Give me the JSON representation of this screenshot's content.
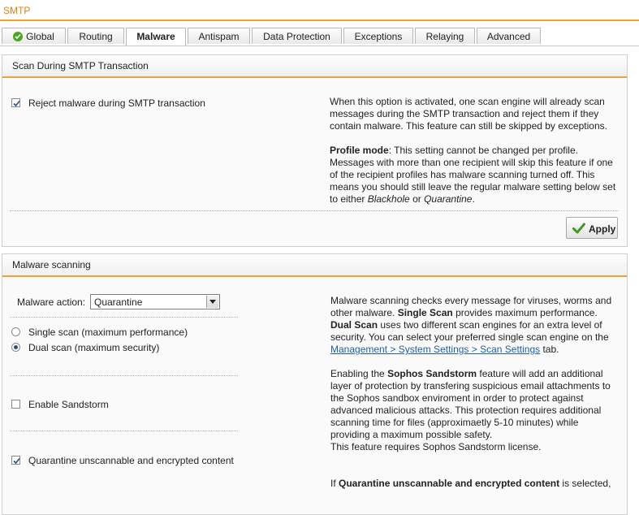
{
  "page": {
    "title": "SMTP"
  },
  "tabs": [
    {
      "label": "Global",
      "status_icon": "ok-check-icon"
    },
    {
      "label": "Routing"
    },
    {
      "label": "Malware",
      "active": true
    },
    {
      "label": "Antispam"
    },
    {
      "label": "Data Protection"
    },
    {
      "label": "Exceptions"
    },
    {
      "label": "Relaying"
    },
    {
      "label": "Advanced"
    }
  ],
  "scan_panel": {
    "title": "Scan During SMTP Transaction",
    "reject_label": "Reject malware during SMTP transaction",
    "reject_checked": true,
    "help_p1": "When this option is activated, one scan engine will already scan messages during the SMTP transaction and reject them if they contain malware. This feature can still be skipped by exceptions.",
    "profile_mode_label": "Profile mode",
    "profile_mode_text_1": ": This setting cannot be changed per profile. Messages with more than one recipient will skip this feature if one of the recipient profiles has malware scanning turned off. This means you should still leave the regular malware setting below set to either ",
    "blackhole": "Blackhole",
    "or_word": " or ",
    "quarantine_word": "Quarantine",
    "period": ".",
    "apply_label": "Apply"
  },
  "malware_panel": {
    "title": "Malware scanning",
    "action_label": "Malware action:",
    "action_value": "Quarantine",
    "single_scan_label": "Single scan (maximum performance)",
    "dual_scan_label": "Dual scan (maximum security)",
    "selected_scan": "dual",
    "sandstorm_label": "Enable Sandstorm",
    "sandstorm_checked": false,
    "quarantine_unscannable_label": "Quarantine unscannable and encrypted content",
    "quarantine_unscannable_checked": true,
    "help1_a": "Malware scanning checks every message for viruses, worms and other malware. ",
    "help1_single": "Single Scan",
    "help1_b": " provides maximum performance. ",
    "help1_dual": "Dual Scan",
    "help1_c": " uses two different scan engines for an extra level of security. You can select your preferred single scan engine on the ",
    "help1_link": "Management > System Settings > Scan Settings",
    "help1_d": " tab.",
    "help2_a": "Enabling the ",
    "help2_bold": "Sophos Sandstorm",
    "help2_b": " feature will add an additional layer of protection by transfering suspicious email attachments to the Sophos sandbox enviroment in order to protect against advanced malicious attacks. This protection requires additional scanning time for files (approximaetly 5-10 minutes) while providing a maximum possible safety.",
    "help2_c": "This feature requires Sophos Sandstorm license.",
    "help3_a": "If ",
    "help3_bold": "Quarantine unscannable and encrypted content",
    "help3_b": " is selected,"
  },
  "colors": {
    "accent": "#e8a33a",
    "title_text": "#e07f10",
    "ok_green": "#4aa520",
    "link": "#1f5fa6"
  }
}
